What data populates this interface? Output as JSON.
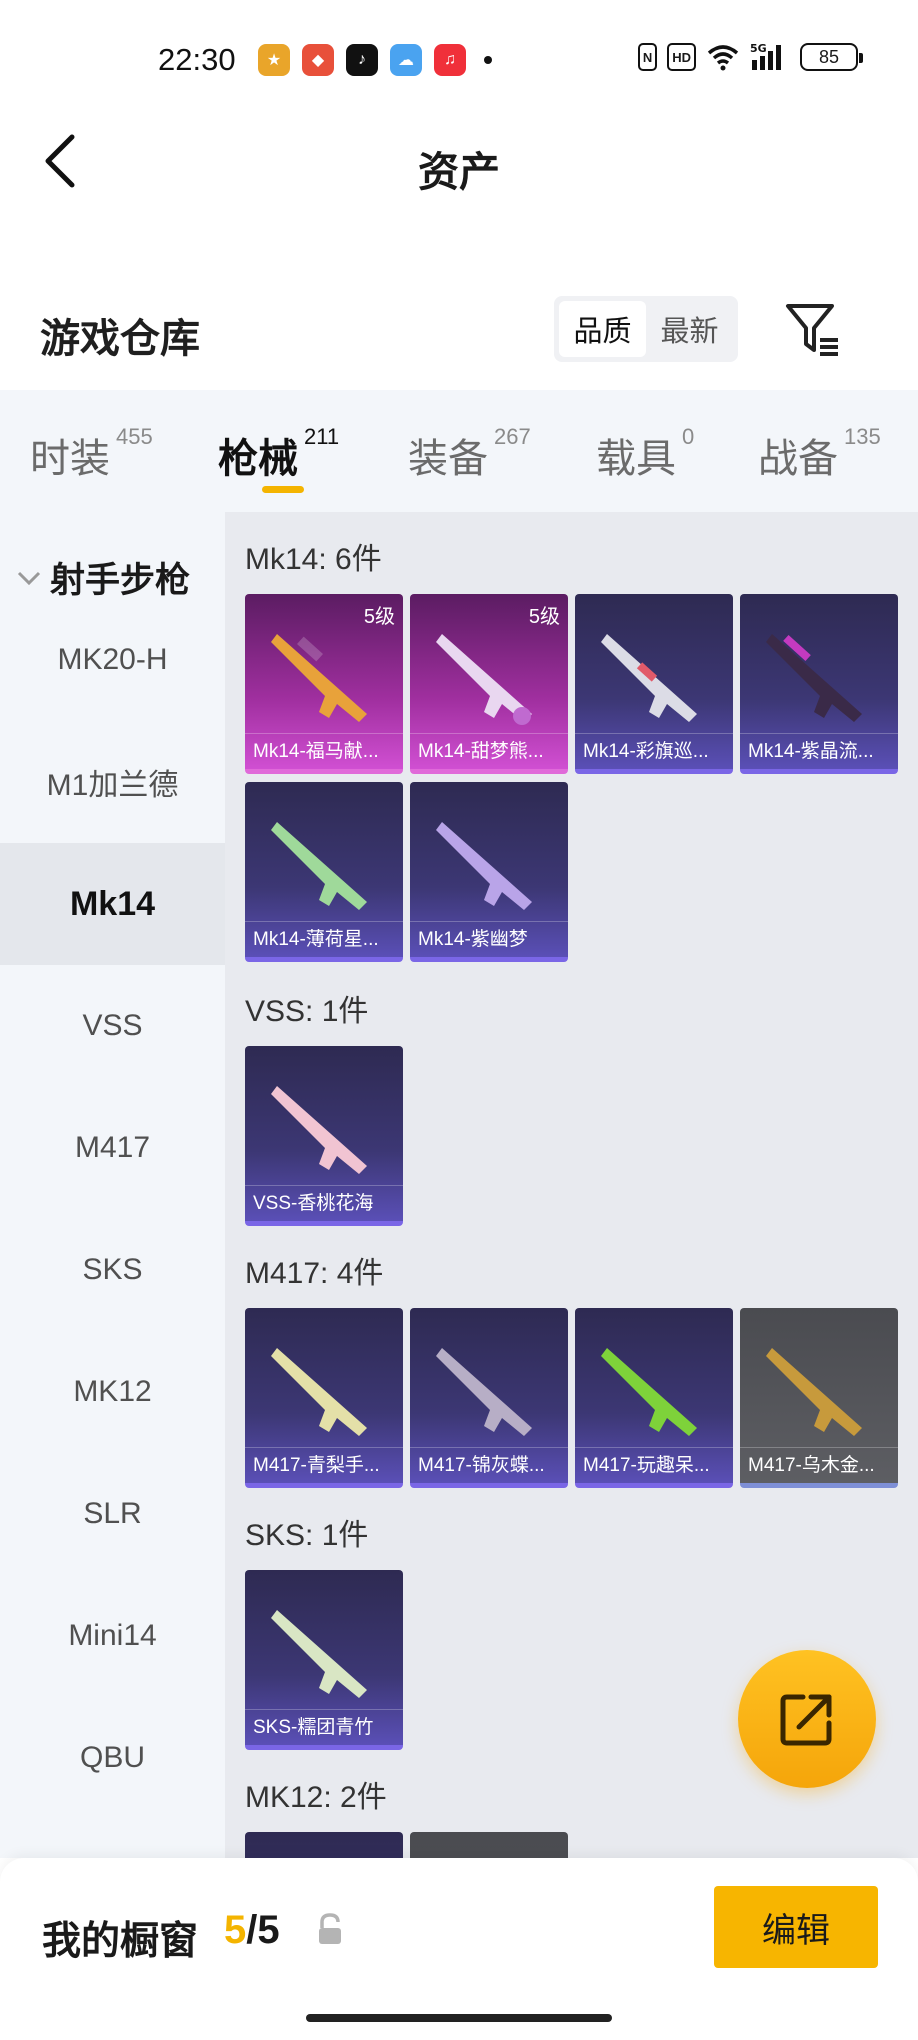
{
  "status_bar": {
    "time": "22:30",
    "apps": [
      {
        "icon": "game-app-icon",
        "color": "#e9a52a"
      },
      {
        "icon": "game-controller-app-icon",
        "color": "#e8503a"
      },
      {
        "icon": "tiktok-app-icon",
        "color": "#111111"
      },
      {
        "icon": "weather-app-icon",
        "color": "#4aa3f0"
      },
      {
        "icon": "music-app-icon",
        "color": "#f0303a"
      }
    ],
    "nfc": "N",
    "hd": "HD",
    "network": "5G",
    "battery": "85"
  },
  "header": {
    "title": "资产"
  },
  "section": {
    "title": "游戏仓库",
    "sort_options": [
      "品质",
      "最新"
    ],
    "sort_selected": "品质"
  },
  "tabs": [
    {
      "label": "时装",
      "count": "455"
    },
    {
      "label": "枪械",
      "count": "211",
      "active": true
    },
    {
      "label": "装备",
      "count": "267"
    },
    {
      "label": "载具",
      "count": "0"
    },
    {
      "label": "战备",
      "count": "135"
    }
  ],
  "sidebar": {
    "category": "射手步枪",
    "items": [
      "MK20-H",
      "M1加兰德",
      "Mk14",
      "VSS",
      "M417",
      "SKS",
      "MK12",
      "SLR",
      "Mini14",
      "QBU"
    ],
    "selected": "Mk14"
  },
  "groups": [
    {
      "title": "Mk14: 6件",
      "items": [
        {
          "name": "Mk14-福马献...",
          "level": "5级",
          "rarity": "pink"
        },
        {
          "name": "Mk14-甜梦熊...",
          "level": "5级",
          "rarity": "pink"
        },
        {
          "name": "Mk14-彩旗巡...",
          "rarity": "purple"
        },
        {
          "name": "Mk14-紫晶流...",
          "rarity": "purple"
        },
        {
          "name": "Mk14-薄荷星...",
          "rarity": "purple"
        },
        {
          "name": "Mk14-紫幽梦",
          "rarity": "purple"
        }
      ]
    },
    {
      "title": "VSS: 1件",
      "items": [
        {
          "name": "VSS-香桃花海",
          "rarity": "purple"
        }
      ]
    },
    {
      "title": "M417: 4件",
      "items": [
        {
          "name": "M417-青梨手...",
          "rarity": "purple"
        },
        {
          "name": "M417-锦灰蝶...",
          "rarity": "purple"
        },
        {
          "name": "M417-玩趣呆...",
          "rarity": "purple"
        },
        {
          "name": "M417-乌木金...",
          "rarity": "gray"
        }
      ]
    },
    {
      "title": "SKS: 1件",
      "items": [
        {
          "name": "SKS-糯团青竹",
          "rarity": "purple"
        }
      ]
    },
    {
      "title": "MK12: 2件",
      "items": []
    }
  ],
  "bottom": {
    "showcase_label": "我的橱窗",
    "current": "5",
    "separator": "/",
    "total": "5",
    "edit_label": "编辑"
  },
  "colors": {
    "accent": "#f7b500",
    "pink_rarity": "#d04fd2",
    "purple_rarity": "#5a4fb6"
  }
}
